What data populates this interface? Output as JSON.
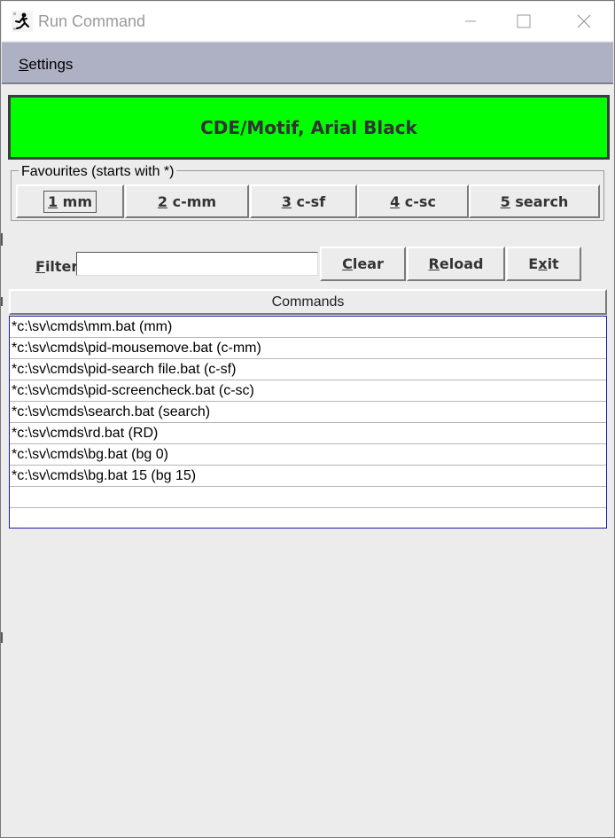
{
  "window": {
    "title": "Run Command",
    "minimize_glyph": "—",
    "maximize_glyph": "☐",
    "close_glyph": "✕"
  },
  "menu": {
    "settings_mnemonic": "S",
    "settings_rest": "ettings"
  },
  "banner": {
    "text": "CDE/Motif, Arial Black",
    "color": "#00ff00"
  },
  "favourites": {
    "legend": "Favourites (starts with *)",
    "buttons": [
      {
        "num": "1",
        "label": " mm"
      },
      {
        "num": "2",
        "label": " c-mm"
      },
      {
        "num": "3",
        "label": " c-sf"
      },
      {
        "num": "4",
        "label": " c-sc"
      },
      {
        "num": "5",
        "label": " search"
      }
    ]
  },
  "filter": {
    "label_mnemonic": "F",
    "label_rest": "ilter",
    "value": ""
  },
  "actions": {
    "clear_mnemonic": "C",
    "clear_rest": "lear",
    "reload_mnemonic": "R",
    "reload_rest": "eload",
    "exit_pre": "E",
    "exit_mnemonic": "x",
    "exit_post": "it"
  },
  "table": {
    "header": "Commands",
    "rows": [
      "*c:\\sv\\cmds\\mm.bat (mm)",
      "*c:\\sv\\cmds\\pid-mousemove.bat (c-mm)",
      "*c:\\sv\\cmds\\pid-search file.bat (c-sf)",
      "*c:\\sv\\cmds\\pid-screencheck.bat (c-sc)",
      "*c:\\sv\\cmds\\search.bat (search)",
      "*c:\\sv\\cmds\\rd.bat (RD)",
      "*c:\\sv\\cmds\\bg.bat (bg 0)",
      "*c:\\sv\\cmds\\bg.bat 15 (bg 15)",
      "",
      ""
    ]
  }
}
